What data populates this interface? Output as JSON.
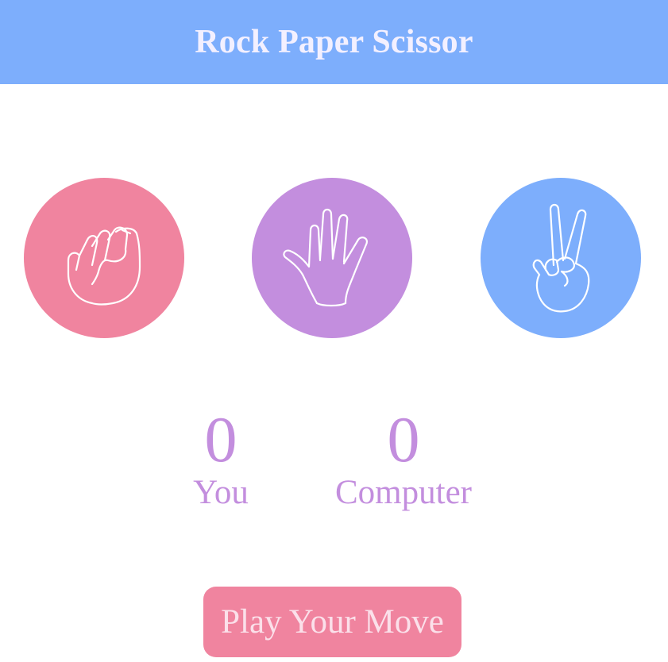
{
  "header": {
    "title": "Rock Paper Scissor",
    "bg_color": "#7daefc"
  },
  "choices": [
    {
      "name": "rock",
      "icon": "fist-icon",
      "color": "#f0849f"
    },
    {
      "name": "paper",
      "icon": "open-hand-icon",
      "color": "#c38ede"
    },
    {
      "name": "scissor",
      "icon": "peace-hand-icon",
      "color": "#7daefc"
    }
  ],
  "scoreboard": {
    "user": {
      "score": "0",
      "label": "You"
    },
    "computer": {
      "score": "0",
      "label": "Computer"
    },
    "color": "#c38ede"
  },
  "play_button": {
    "label": "Play Your Move",
    "color": "#f0849f"
  }
}
